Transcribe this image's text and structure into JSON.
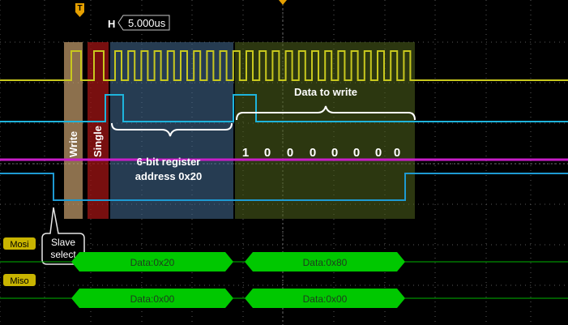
{
  "header": {
    "trigger_marker": "T",
    "horizontal_label": "H",
    "timebase": "5.000us"
  },
  "annotations": {
    "write": "Write",
    "single": "Single",
    "register_line1": "6-bit register",
    "register_line2": "address 0x20",
    "data_to_write": "Data to write",
    "bits": [
      "1",
      "0",
      "0",
      "0",
      "0",
      "0",
      "0",
      "0"
    ],
    "slave_select_line1": "Slave",
    "slave_select_line2": "select"
  },
  "bus": {
    "mosi": {
      "label": "Mosi",
      "packets": [
        "Data:0x20",
        "Data:0x80"
      ]
    },
    "miso": {
      "label": "Miso",
      "packets": [
        "Data:0x00",
        "Data:0x00"
      ]
    }
  },
  "colors": {
    "clock": "#c8c81e",
    "mosi_trace": "#1eb4dc",
    "miso_trace": "#c81ec8",
    "cs_trace": "#1e9ad2",
    "bus_fill": "#00c800",
    "bus_label": "#c8b400",
    "write_band": "#c8a06e",
    "single_band": "#a01414",
    "addr_band": "#466e96",
    "data_band": "#50641e"
  }
}
